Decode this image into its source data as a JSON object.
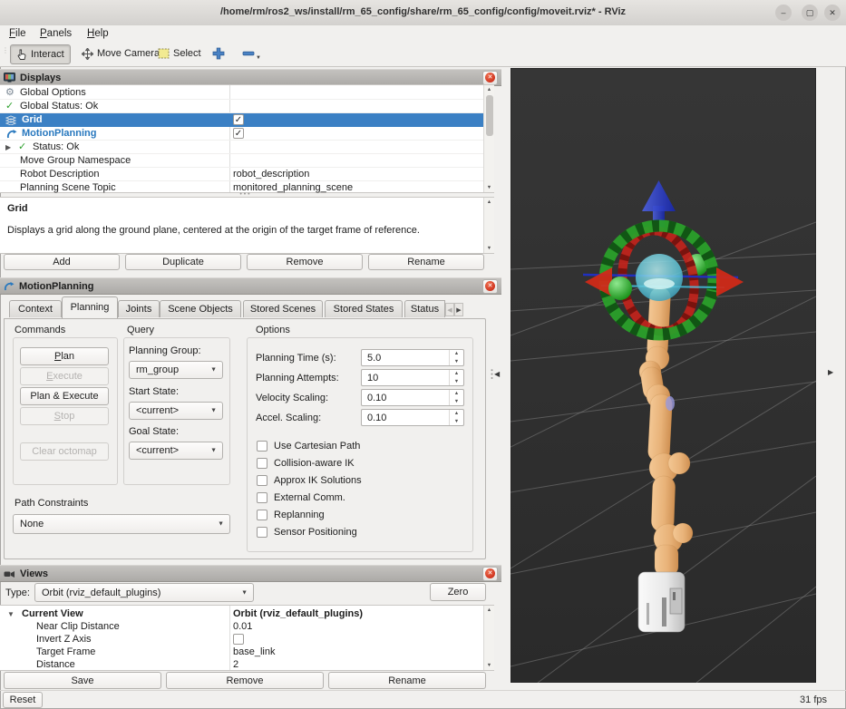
{
  "window": {
    "title": "/home/rm/ros2_ws/install/rm_65_config/share/rm_65_config/config/moveit.rviz* - RViz"
  },
  "menu": {
    "file": "File",
    "panels": "Panels",
    "help": "Help"
  },
  "toolbar": {
    "interact": "Interact",
    "move_camera": "Move Camera",
    "select": "Select"
  },
  "displays": {
    "title": "Displays",
    "rows": [
      {
        "label": "Global Options",
        "value": "",
        "icon": "gear-icon"
      },
      {
        "label": "Global Status: Ok",
        "value": "",
        "icon": "check-icon"
      },
      {
        "label": "Grid",
        "value": "",
        "icon": "grid-icon",
        "checked": true,
        "selected": true
      },
      {
        "label": "MotionPlanning",
        "value": "",
        "icon": "motionplanning-icon",
        "checked": true
      },
      {
        "label": "Status: Ok",
        "value": "",
        "icon": "check-icon",
        "expandable": true
      },
      {
        "label": "Move Group Namespace",
        "value": ""
      },
      {
        "label": "Robot Description",
        "value": "robot_description"
      },
      {
        "label": "Planning Scene Topic",
        "value": "monitored_planning_scene"
      }
    ],
    "selected_name": "Grid",
    "selected_description": "Displays a grid along the ground plane, centered at the origin of the target frame of reference.",
    "buttons": {
      "add": "Add",
      "duplicate": "Duplicate",
      "remove": "Remove",
      "rename": "Rename"
    }
  },
  "motion_planning": {
    "title": "MotionPlanning",
    "tabs": [
      "Context",
      "Planning",
      "Joints",
      "Scene Objects",
      "Stored Scenes",
      "Stored States",
      "Status"
    ],
    "active_tab": "Planning",
    "commands": {
      "heading": "Commands",
      "plan": "Plan",
      "execute": "Execute",
      "plan_execute": "Plan & Execute",
      "stop": "Stop",
      "clear_octomap": "Clear octomap"
    },
    "query": {
      "heading": "Query",
      "planning_group_label": "Planning Group:",
      "planning_group_value": "rm_group",
      "start_state_label": "Start State:",
      "start_state_value": "<current>",
      "goal_state_label": "Goal State:",
      "goal_state_value": "<current>"
    },
    "options": {
      "heading": "Options",
      "fields": [
        {
          "label": "Planning Time (s):",
          "value": "5.0"
        },
        {
          "label": "Planning Attempts:",
          "value": "10"
        },
        {
          "label": "Velocity Scaling:",
          "value": "0.10"
        },
        {
          "label": "Accel. Scaling:",
          "value": "0.10"
        }
      ],
      "checkboxes": [
        {
          "label": "Use Cartesian Path",
          "checked": false
        },
        {
          "label": "Collision-aware IK",
          "checked": false
        },
        {
          "label": "Approx IK Solutions",
          "checked": false
        },
        {
          "label": "External Comm.",
          "checked": false
        },
        {
          "label": "Replanning",
          "checked": false
        },
        {
          "label": "Sensor Positioning",
          "checked": false
        }
      ]
    },
    "path_constraints": {
      "label": "Path Constraints",
      "value": "None"
    }
  },
  "views": {
    "title": "Views",
    "type_label": "Type:",
    "type_value": "Orbit (rviz_default_plugins)",
    "zero_button": "Zero",
    "tree": [
      {
        "label": "Current View",
        "value": "Orbit (rviz_default_plugins)"
      },
      {
        "label": "Near Clip Distance",
        "value": "0.01"
      },
      {
        "label": "Invert Z Axis",
        "value": "",
        "checkbox": false
      },
      {
        "label": "Target Frame",
        "value": "base_link"
      },
      {
        "label": "Distance",
        "value": "2"
      }
    ],
    "buttons": {
      "save": "Save",
      "remove": "Remove",
      "rename": "Rename"
    }
  },
  "statusbar": {
    "reset": "Reset",
    "fps": "31 fps"
  },
  "colors": {
    "selection_blue": "#3b80c4",
    "motionplanning_blue": "#2878be",
    "status_green": "#2fa12f",
    "close_red": "#c31f0e",
    "viewport_bg": "#2f2f2f",
    "robot_tan": "#e9b77e",
    "marker_green": "#2aa02a",
    "marker_red": "#cc2a1a",
    "marker_blue": "#2b3fd4",
    "marker_cyan": "#54c8d8"
  },
  "icons": {
    "close": "✕",
    "minimize": "–",
    "maximize": "▢",
    "close_window": "✕",
    "check": "✓",
    "gear": "⚙",
    "expander_right": "▶",
    "expander_down": "▼",
    "dropdown_arrow": "▼",
    "spin_up": "▲",
    "spin_down": "▼",
    "scroll_up": "▲",
    "scroll_down": "▼",
    "tab_left": "◀",
    "tab_right": "▶",
    "collapse_left": "◀",
    "collapse_right": "▶",
    "drag_dots": "⋮⋮",
    "splitter_dots": "• • •"
  }
}
